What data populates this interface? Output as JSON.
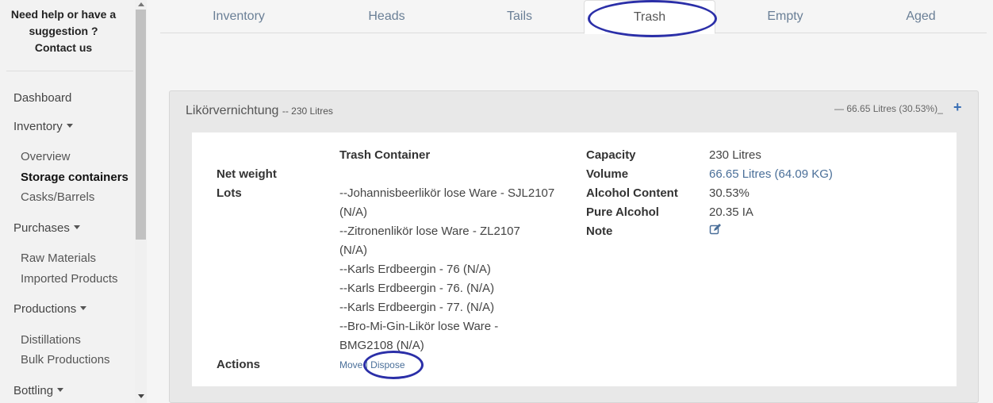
{
  "sidebar": {
    "help_line1": "Need help or have a",
    "help_line2": "suggestion ?",
    "help_line3": "Contact us",
    "dashboard": "Dashboard",
    "inventory": "Inventory",
    "overview": "Overview",
    "storage_containers": "Storage containers",
    "casks_barrels": "Casks/Barrels",
    "purchases": "Purchases",
    "raw_materials": "Raw Materials",
    "imported_products": "Imported Products",
    "productions": "Productions",
    "distillations": "Distillations",
    "bulk_productions": "Bulk Productions",
    "bottling": "Bottling"
  },
  "tabs": [
    "Inventory",
    "Heads",
    "Tails",
    "Trash",
    "Empty",
    "Aged"
  ],
  "active_tab": "Trash",
  "panel": {
    "name": "Likörvernichtung",
    "capacity_suffix": "-- 230 Litres",
    "summary": "— 66.65 Litres (30.53%)_",
    "plus": "+"
  },
  "details": {
    "container_type": "Trash Container",
    "net_weight_label": "Net weight",
    "lots_label": "Lots",
    "lots": [
      "--Johannisbeerlikör lose Ware - SJL2107",
      "(N/A)",
      "--Zitronenlikör lose Ware - ZL2107",
      "(N/A)",
      "--Karls Erdbeergin - 76 (N/A)",
      "--Karls Erdbeergin - 76. (N/A)",
      "--Karls Erdbeergin - 77. (N/A)",
      "--Bro-Mi-Gin-Likör lose Ware -",
      "BMG2108 (N/A)"
    ],
    "actions_label": "Actions",
    "move": "Move",
    "separator": "|",
    "dispose": "Dispose",
    "capacity_label": "Capacity",
    "capacity_value": "230 Litres",
    "volume_label": "Volume",
    "volume_value": "66.65 Litres (64.09 KG)",
    "alcohol_label": "Alcohol Content",
    "alcohol_value": "30.53%",
    "pure_label": "Pure Alcohol",
    "pure_value": "20.35 IA",
    "note_label": "Note"
  },
  "colors": {
    "annotation": "#2b2fa8",
    "link": "#4a6f99",
    "tab_text": "#6a7f96"
  },
  "icons": {
    "note": "edit-icon",
    "scroll_up": "arrow-up-icon",
    "scroll_down": "arrow-down-icon",
    "dropdown": "caret-down-icon"
  }
}
